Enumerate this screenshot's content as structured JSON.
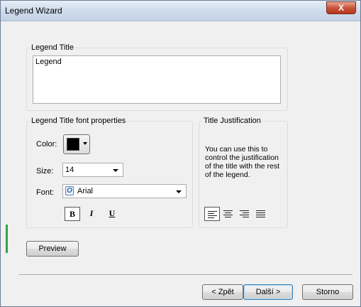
{
  "window": {
    "title": "Legend Wizard",
    "close_label": "X"
  },
  "legend_title_group": {
    "label": "Legend Title",
    "value": "Legend"
  },
  "font_group": {
    "label": "Legend Title font properties",
    "color_label": "Color:",
    "color_value": "#000000",
    "size_label": "Size:",
    "size_value": "14",
    "font_label": "Font:",
    "font_value": "Arial",
    "font_icon": "O",
    "bold_label": "B",
    "italic_label": "I",
    "underline_label": "U"
  },
  "justification_group": {
    "label": "Title Justification",
    "description": "You can use this to control the justification of the title with the rest of the legend.",
    "options": [
      "left-align-icon",
      "center-align-icon",
      "right-align-icon",
      "justify-align-icon"
    ],
    "selected": "left-align-icon"
  },
  "buttons": {
    "preview": "Preview",
    "back": "< Zpět",
    "next": "Další >",
    "cancel": "Storno"
  }
}
